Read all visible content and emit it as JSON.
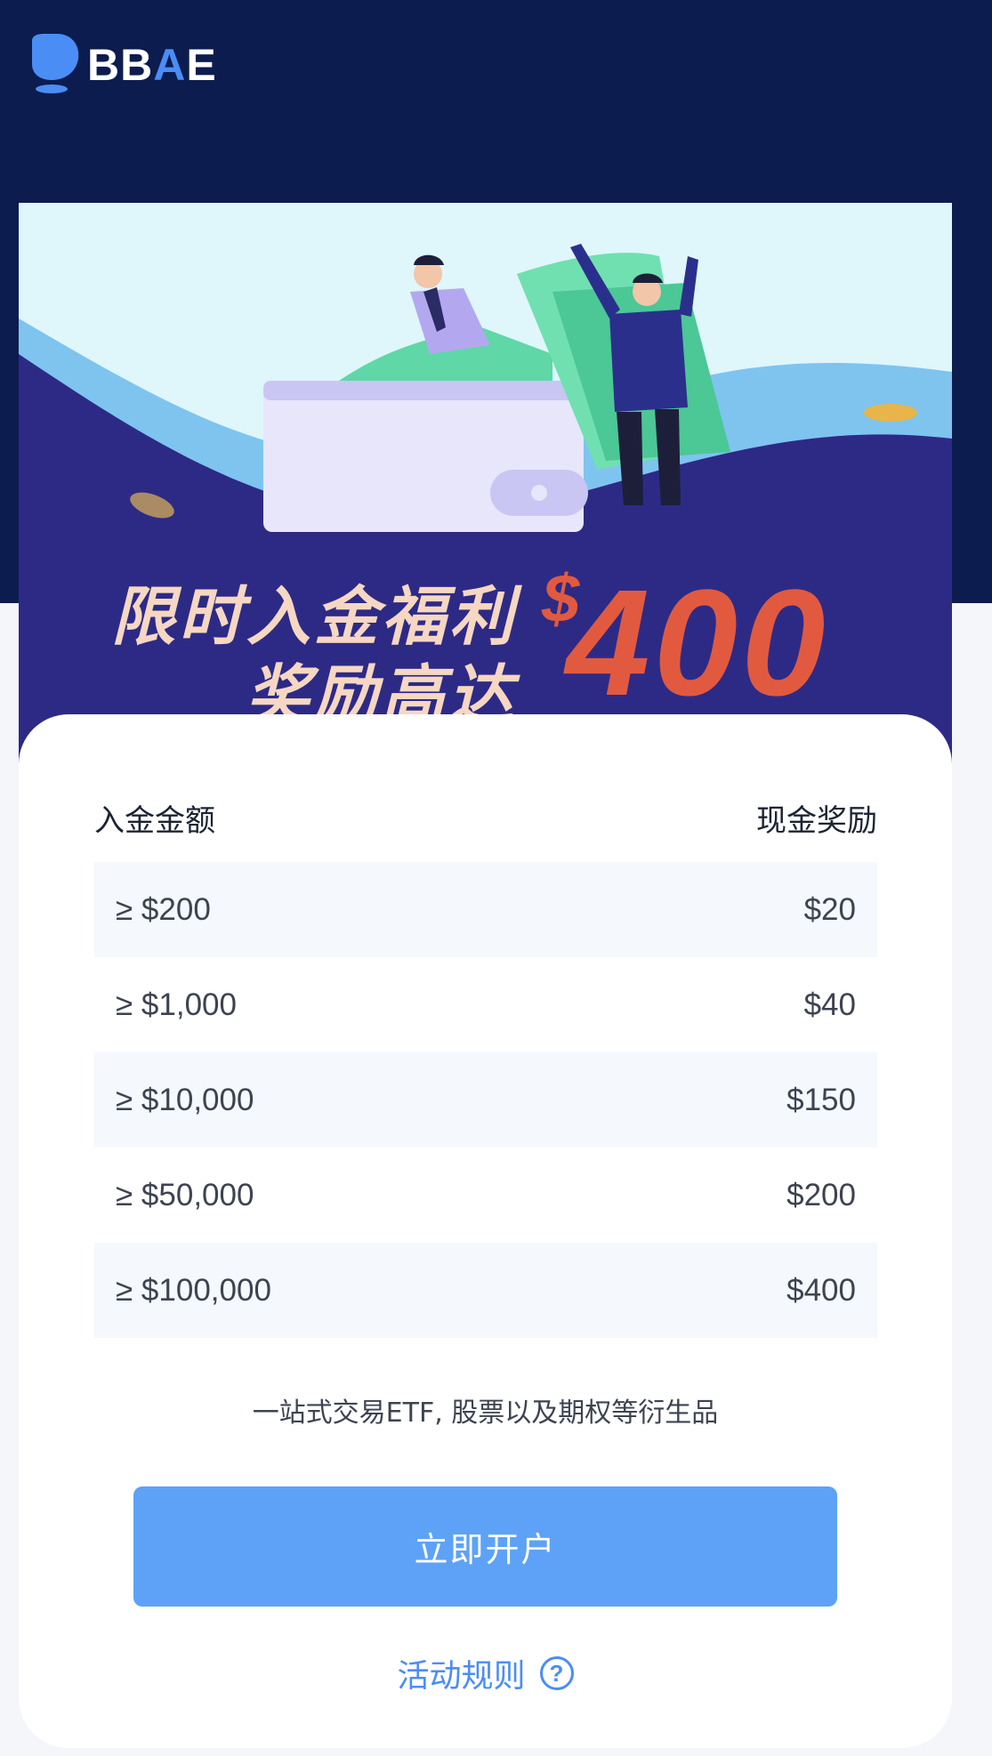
{
  "brand": {
    "logo_text_1": "BB",
    "logo_text_accent": "A",
    "logo_text_2": "E",
    "accent_color": "#4a8df5",
    "header_bg": "#0c1c4e"
  },
  "banner": {
    "headline_line1": "限时入金福利",
    "headline_line2": "奖励高达",
    "currency_symbol": "$",
    "amount": "400",
    "headline_color": "#f6d7c2",
    "amount_color": "#e15a3f"
  },
  "reward_table": {
    "col_deposit": "入金金额",
    "col_reward": "现金奖励",
    "rows": [
      {
        "deposit": "≥ $200",
        "reward": "$20"
      },
      {
        "deposit": "≥ $1,000",
        "reward": "$40"
      },
      {
        "deposit": "≥ $10,000",
        "reward": "$150"
      },
      {
        "deposit": "≥ $50,000",
        "reward": "$200"
      },
      {
        "deposit": "≥ $100,000",
        "reward": "$400"
      }
    ]
  },
  "tagline": "一站式交易ETF, 股票以及期权等衍生品",
  "cta": {
    "label": "立即开户",
    "color": "#5ea2f7"
  },
  "rules_link": {
    "label": "活动规则",
    "icon": "question-circle-icon"
  }
}
